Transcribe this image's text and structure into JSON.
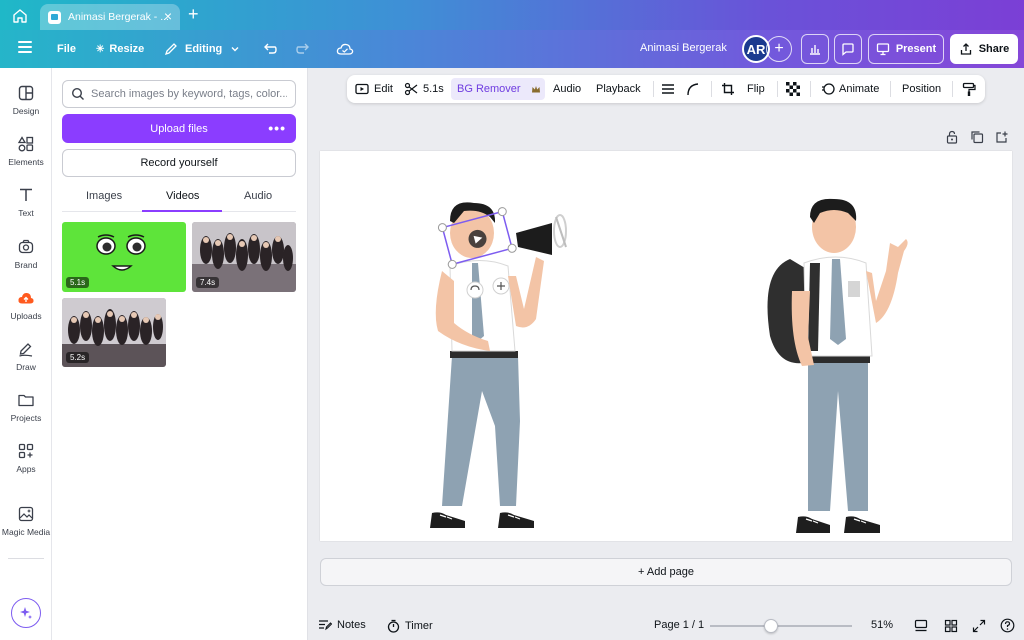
{
  "browser": {
    "tab_title": "Animasi Bergerak - ..."
  },
  "header": {
    "file_label": "File",
    "resize_label": "Resize",
    "editing_label": "Editing",
    "project_title": "Animasi Bergerak",
    "avatar_initials": "AR",
    "present_label": "Present",
    "share_label": "Share"
  },
  "rail": {
    "items": [
      {
        "label": "Design",
        "icon": "design-icon"
      },
      {
        "label": "Elements",
        "icon": "elements-icon"
      },
      {
        "label": "Text",
        "icon": "text-icon"
      },
      {
        "label": "Brand",
        "icon": "brand-icon"
      },
      {
        "label": "Uploads",
        "icon": "upload-cloud-icon"
      },
      {
        "label": "Draw",
        "icon": "draw-icon"
      },
      {
        "label": "Projects",
        "icon": "folder-icon"
      },
      {
        "label": "Apps",
        "icon": "apps-icon"
      },
      {
        "label": "Magic Media",
        "icon": "magic-media-icon"
      }
    ]
  },
  "panel": {
    "search_placeholder": "Search images by keyword, tags, color...",
    "upload_label": "Upload files",
    "record_label": "Record yourself",
    "tabs": [
      "Images",
      "Videos",
      "Audio"
    ],
    "active_tab": "Videos",
    "videos": [
      {
        "duration": "5.1s"
      },
      {
        "duration": "7.4s"
      },
      {
        "duration": "5.2s"
      }
    ]
  },
  "toolbar": {
    "edit_label": "Edit",
    "trim_label": "5.1s",
    "bg_remover_label": "BG Remover",
    "audio_label": "Audio",
    "playback_label": "Playback",
    "flip_label": "Flip",
    "animate_label": "Animate",
    "position_label": "Position"
  },
  "canvas": {
    "add_page_label": "+ Add page"
  },
  "footer": {
    "notes_label": "Notes",
    "timer_label": "Timer",
    "page_indicator": "Page 1 / 1",
    "zoom_label": "51%",
    "zoom_fraction": 0.51
  },
  "colors": {
    "accent": "#8b3dff",
    "header_start": "#25b5c9",
    "header_end": "#8547d8"
  }
}
